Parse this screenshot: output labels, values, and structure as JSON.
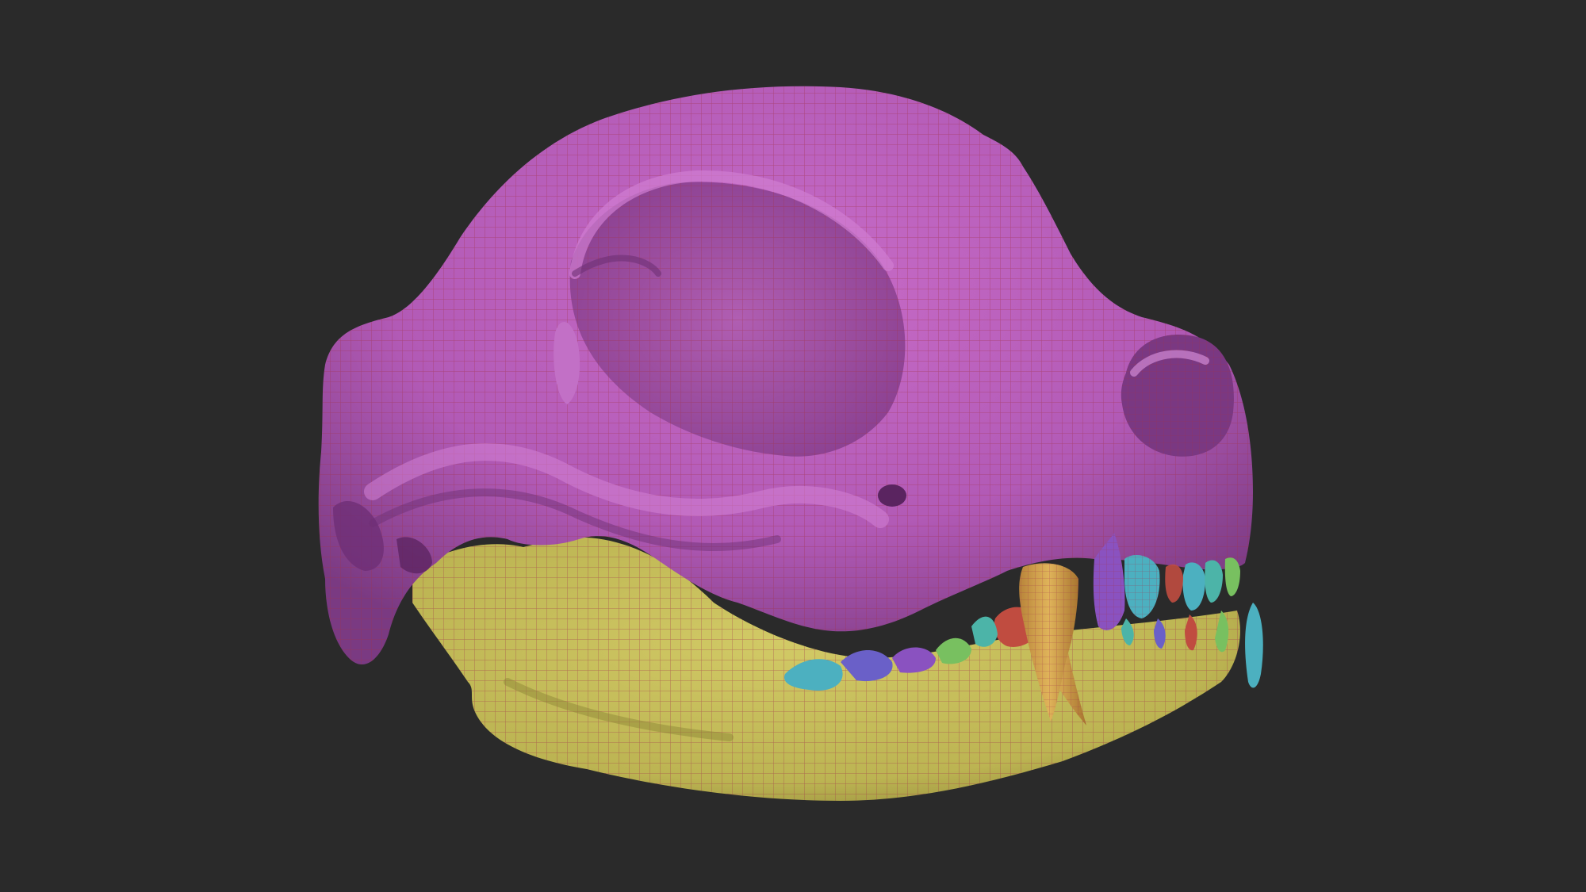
{
  "viewport": {
    "background_color": "#2a2a2a"
  },
  "model": {
    "subject": "skull-3d-model",
    "display_mode": "polygroups-with-wireframe",
    "wire_color": "#a0324a",
    "polygroup_colors": {
      "cranium": "#b45ab8",
      "mandible": "#c4bc58",
      "canine_upper": "#d0a04c",
      "canine_lower": "#d2a24e",
      "incisors_cyan": "#4cb0c0",
      "teeth_green": "#78c060",
      "teeth_red": "#c04c40",
      "teeth_blue": "#6a60c8",
      "teeth_purple": "#8a52c0",
      "teeth_teal": "#4cb4a8"
    }
  }
}
